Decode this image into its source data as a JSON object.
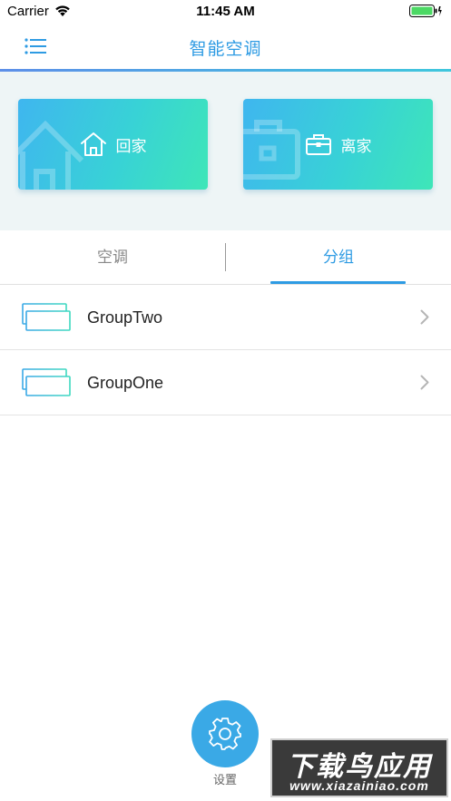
{
  "status_bar": {
    "carrier": "Carrier",
    "time": "11:45 AM"
  },
  "nav": {
    "title": "智能空调",
    "menu_icon": "menu-icon"
  },
  "modes": [
    {
      "label": "回家",
      "icon": "home-icon"
    },
    {
      "label": "离家",
      "icon": "briefcase-icon"
    }
  ],
  "tabs": [
    {
      "label": "空调",
      "active": false
    },
    {
      "label": "分组",
      "active": true
    }
  ],
  "groups": [
    {
      "name": "GroupTwo",
      "icon": "air-conditioner-icon"
    },
    {
      "name": "GroupOne",
      "icon": "air-conditioner-icon"
    }
  ],
  "settings": {
    "label": "设置",
    "icon": "gear-icon"
  },
  "watermark": {
    "title": "下载鸟应用",
    "url": "www.xiazainiao.com"
  },
  "colors": {
    "accent": "#2e9be3",
    "card_start": "#3fb6ef",
    "card_end": "#3ee6b8",
    "fab": "#3aa9e6"
  }
}
